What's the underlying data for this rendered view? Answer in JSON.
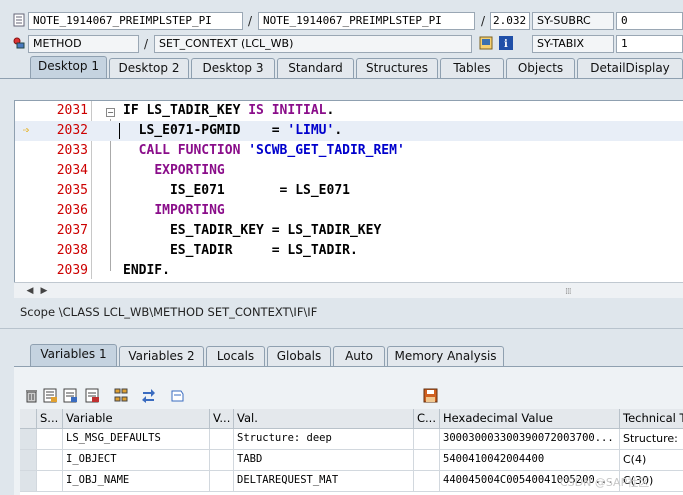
{
  "header": {
    "row1": {
      "program": "NOTE_1914067_PREIMPLSTEP_PI",
      "include": "NOTE_1914067_PREIMPLSTEP_PI",
      "line_no": "2.032",
      "sysfield_name": "SY-SUBRC",
      "sysfield_value": "0"
    },
    "row2": {
      "event_type": "METHOD",
      "event_name": "SET_CONTEXT (LCL_WB)",
      "sysfield_name": "SY-TABIX",
      "sysfield_value": "1"
    }
  },
  "desktop_tabs": [
    "Desktop 1",
    "Desktop 2",
    "Desktop 3",
    "Standard",
    "Structures",
    "Tables",
    "Objects",
    "DetailDisplay"
  ],
  "active_desktop_tab": 0,
  "code_lines": [
    {
      "num": "2031",
      "indent": "",
      "parts": [
        {
          "t": "IF LS_TADIR_KEY ",
          "c": ""
        },
        {
          "t": "IS INITIAL",
          "c": "kw"
        },
        {
          "t": ".",
          "c": ""
        }
      ]
    },
    {
      "num": "2032",
      "indent": "  ",
      "parts": [
        {
          "t": "LS_E071-PGMID    = ",
          "c": ""
        },
        {
          "t": "'LIMU'",
          "c": "str"
        },
        {
          "t": ".",
          "c": ""
        }
      ]
    },
    {
      "num": "2033",
      "indent": "  ",
      "parts": [
        {
          "t": "CALL FUNCTION ",
          "c": "kw"
        },
        {
          "t": "'SCWB_GET_TADIR_REM'",
          "c": "str"
        }
      ]
    },
    {
      "num": "2034",
      "indent": "    ",
      "parts": [
        {
          "t": "EXPORTING",
          "c": "kw"
        }
      ]
    },
    {
      "num": "2035",
      "indent": "      ",
      "parts": [
        {
          "t": "IS_E071       = LS_E071",
          "c": ""
        }
      ]
    },
    {
      "num": "2036",
      "indent": "    ",
      "parts": [
        {
          "t": "IMPORTING",
          "c": "kw"
        }
      ]
    },
    {
      "num": "2037",
      "indent": "      ",
      "parts": [
        {
          "t": "ES_TADIR_KEY = LS_TADIR_KEY",
          "c": ""
        }
      ]
    },
    {
      "num": "2038",
      "indent": "      ",
      "parts": [
        {
          "t": "ES_TADIR     = LS_TADIR.",
          "c": ""
        }
      ]
    },
    {
      "num": "2039",
      "indent": "",
      "parts": [
        {
          "t": "ENDIF.",
          "c": ""
        }
      ]
    }
  ],
  "current_line": "2032",
  "scope_text": "Scope \\CLASS LCL_WB\\METHOD SET_CONTEXT\\IF\\IF",
  "variable_tabs": [
    "Variables 1",
    "Variables 2",
    "Locals",
    "Globals",
    "Auto",
    "Memory Analysis"
  ],
  "active_variable_tab": 0,
  "variables_table": {
    "columns": [
      "S...",
      "Variable",
      "V...",
      "Val.",
      "C...",
      "Hexadecimal Value",
      "Technical T"
    ],
    "rows": [
      [
        "",
        "LS_MSG_DEFAULTS",
        "",
        "Structure: deep",
        "",
        "300030003300390072003700...",
        "Structure:"
      ],
      [
        "",
        "I_OBJECT",
        "",
        "TABD",
        "",
        "5400410042004400",
        "C(4)"
      ],
      [
        "",
        "I_OBJ_NAME",
        "",
        "DELTAREQUEST_MAT",
        "",
        "440045004C00540041005200...",
        "C(30)"
      ]
    ]
  },
  "watermark": "CSDN @SAP社区",
  "colors": {
    "line_number": "#cc0000",
    "keyword": "#8a0d8a",
    "string": "#0000cc",
    "breakpoint_arrow": "#e6a800"
  }
}
